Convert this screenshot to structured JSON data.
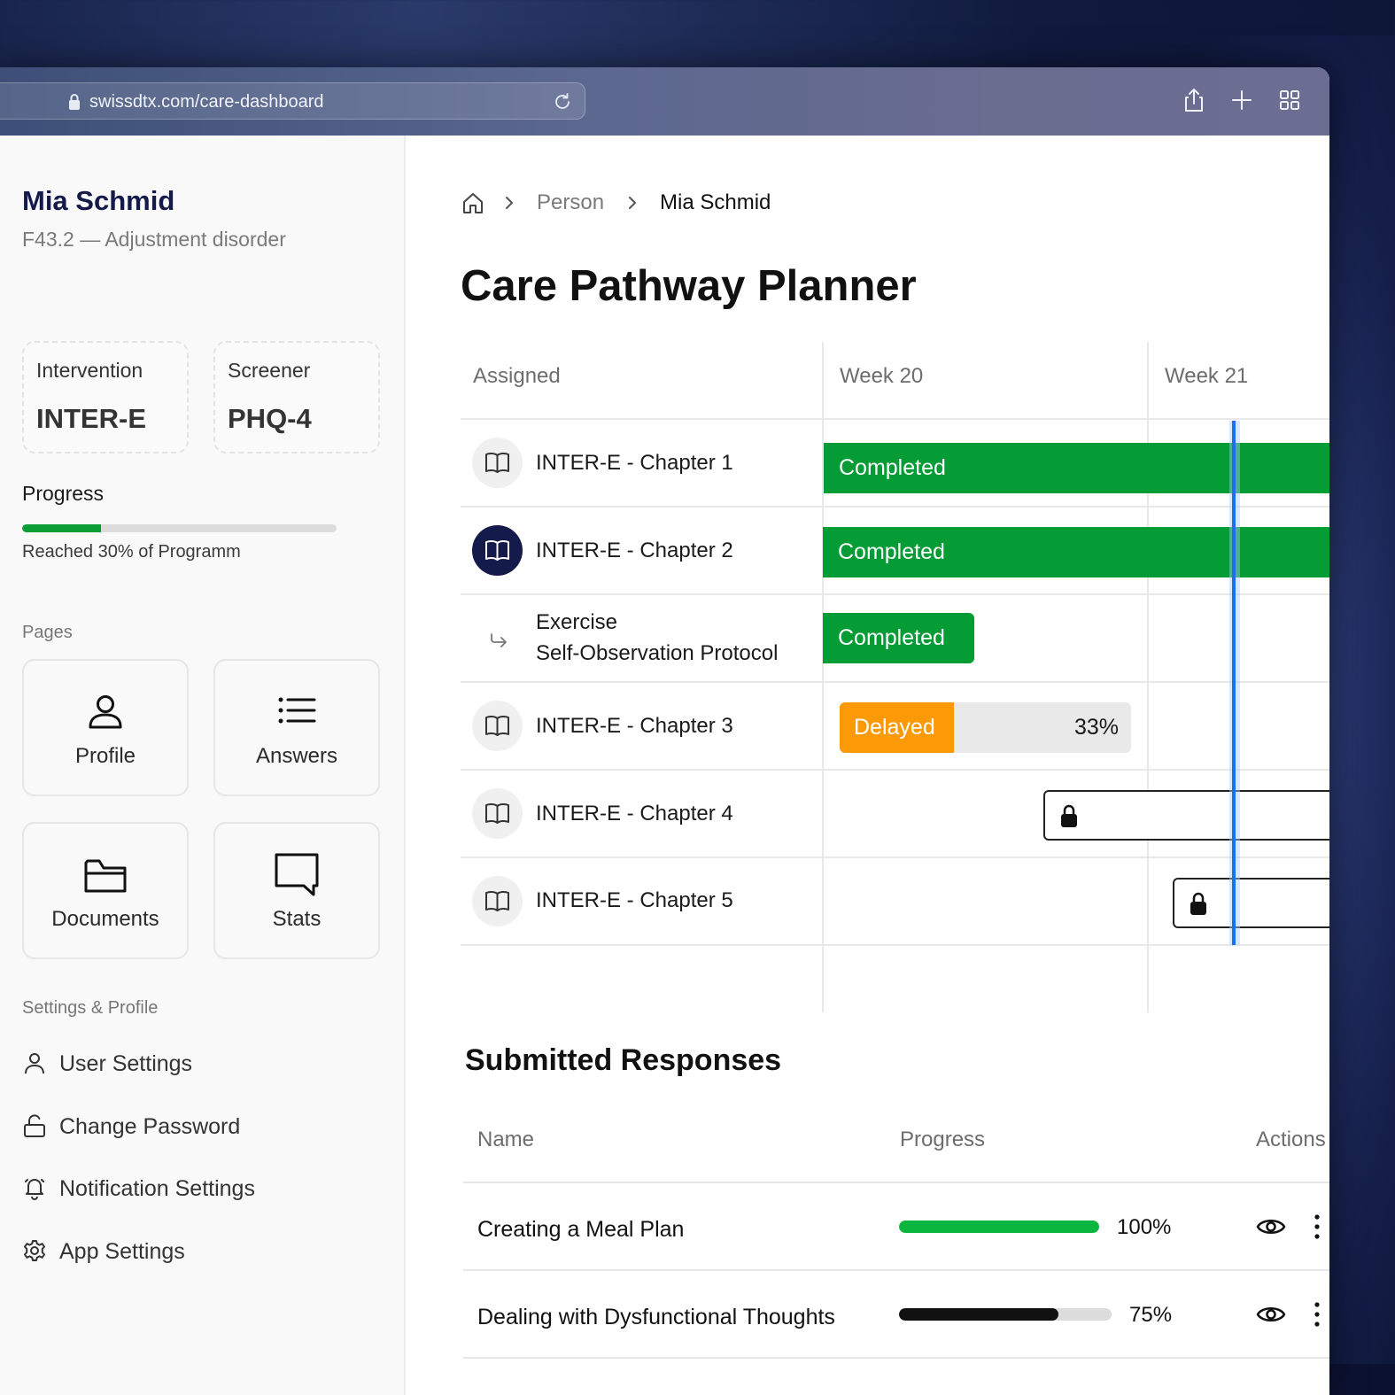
{
  "browser": {
    "url": "swissdtx.com/care-dashboard"
  },
  "patient": {
    "name": "Mia Schmid",
    "diagnosis": "F43.2 — Adjustment disorder"
  },
  "cards": [
    {
      "label": "Intervention",
      "value": "INTER-E"
    },
    {
      "label": "Screener",
      "value": "PHQ-4"
    }
  ],
  "progress": {
    "label": "Progress",
    "value": 0.25,
    "caption": "Reached 30% of Programm",
    "color": "#0b9e37"
  },
  "pages": {
    "label": "Pages",
    "items": [
      {
        "label": "Profile",
        "icon": "user-icon"
      },
      {
        "label": "Answers",
        "icon": "list-icon"
      },
      {
        "label": "Documents",
        "icon": "folder-icon"
      },
      {
        "label": "Stats",
        "icon": "chat-bubble-icon"
      }
    ]
  },
  "settings": {
    "label": "Settings & Profile",
    "items": [
      {
        "label": "User Settings",
        "icon": "user-icon"
      },
      {
        "label": "Change Password",
        "icon": "unlock-icon"
      },
      {
        "label": "Notification Settings",
        "icon": "bell-icon"
      },
      {
        "label": "App Settings",
        "icon": "gear-icon"
      }
    ]
  },
  "breadcrumb": {
    "items": [
      "Person",
      "Mia Schmid"
    ]
  },
  "title": "Care Pathway Planner",
  "gantt": {
    "headers": [
      "Assigned",
      "Week 20",
      "Week 21"
    ],
    "rows": [
      {
        "label": "INTER-E - Chapter 1",
        "icon": "book-icon",
        "status": "Completed"
      },
      {
        "label": "INTER-E - Chapter 2",
        "icon": "book-icon",
        "status": "Completed",
        "active": true
      },
      {
        "label_line1": "Exercise",
        "label_line2": "Self-Observation Protocol",
        "icon": "arrow-return-icon",
        "status": "Completed"
      },
      {
        "label": "INTER-E - Chapter 3",
        "icon": "book-icon",
        "status": "Delayed",
        "percent": "33%"
      },
      {
        "label": "INTER-E - Chapter 4",
        "icon": "book-icon",
        "status": "locked"
      },
      {
        "label": "INTER-E - Chapter 5",
        "icon": "book-icon",
        "status": "locked"
      }
    ],
    "colors": {
      "completed": "#069c35",
      "delayed": "#fb9a06",
      "today": "#1c6ff0"
    }
  },
  "responses": {
    "title": "Submitted Responses",
    "headers": [
      "Name",
      "Progress",
      "Actions"
    ],
    "rows": [
      {
        "name": "Creating a Meal Plan",
        "percent": "100%",
        "value": 1.0,
        "color": "#0bb63e"
      },
      {
        "name": "Dealing with Dysfunctional Thoughts",
        "percent": "75%",
        "value": 0.75,
        "color": "#111111"
      }
    ]
  }
}
